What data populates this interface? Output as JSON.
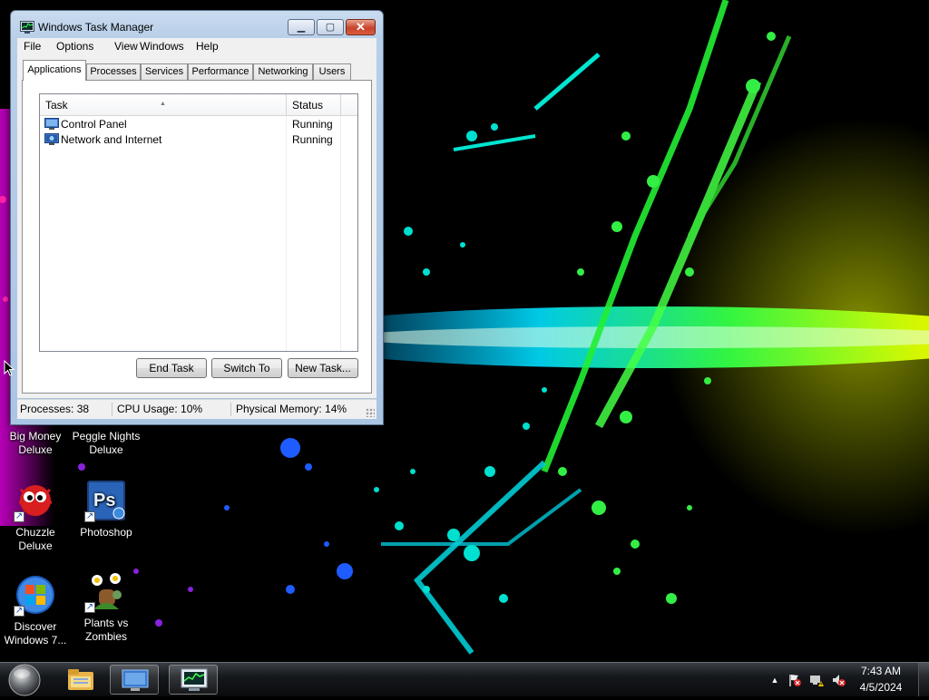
{
  "window": {
    "title": "Windows Task Manager",
    "menu": [
      "File",
      "Options",
      "View",
      "Windows",
      "Help"
    ],
    "tabs": [
      "Applications",
      "Processes",
      "Services",
      "Performance",
      "Networking",
      "Users"
    ],
    "active_tab": "Applications",
    "columns": {
      "task": "Task",
      "status": "Status"
    },
    "tasks": [
      {
        "name": "Control Panel",
        "status": "Running",
        "icon": "control-panel-icon"
      },
      {
        "name": "Network and Internet",
        "status": "Running",
        "icon": "network-icon"
      }
    ],
    "buttons": {
      "end_task": "End Task",
      "switch_to": "Switch To",
      "new_task": "New Task..."
    },
    "status": {
      "processes": "Processes: 38",
      "cpu": "CPU Usage: 10%",
      "memory": "Physical Memory: 14%"
    }
  },
  "desktop_icons": [
    {
      "label_line1": "Big Money",
      "label_line2": "Deluxe"
    },
    {
      "label_line1": "Peggle Nights",
      "label_line2": "Deluxe"
    },
    {
      "label_line1": "Chuzzle",
      "label_line2": "Deluxe"
    },
    {
      "label_line1": "Photoshop",
      "label_line2": ""
    },
    {
      "label_line1": "Discover",
      "label_line2": "Windows 7..."
    },
    {
      "label_line1": "Plants vs",
      "label_line2": "Zombies"
    }
  ],
  "taskbar": {
    "clock_time": "7:43 AM",
    "clock_date": "4/5/2024",
    "pinned": [
      "windows-explorer-icon",
      "control-panel-icon",
      "task-manager-icon"
    ]
  },
  "colors": {
    "titlebar": "#b8cfe8",
    "close_button": "#c7442a",
    "taskbar": "#15181c"
  }
}
